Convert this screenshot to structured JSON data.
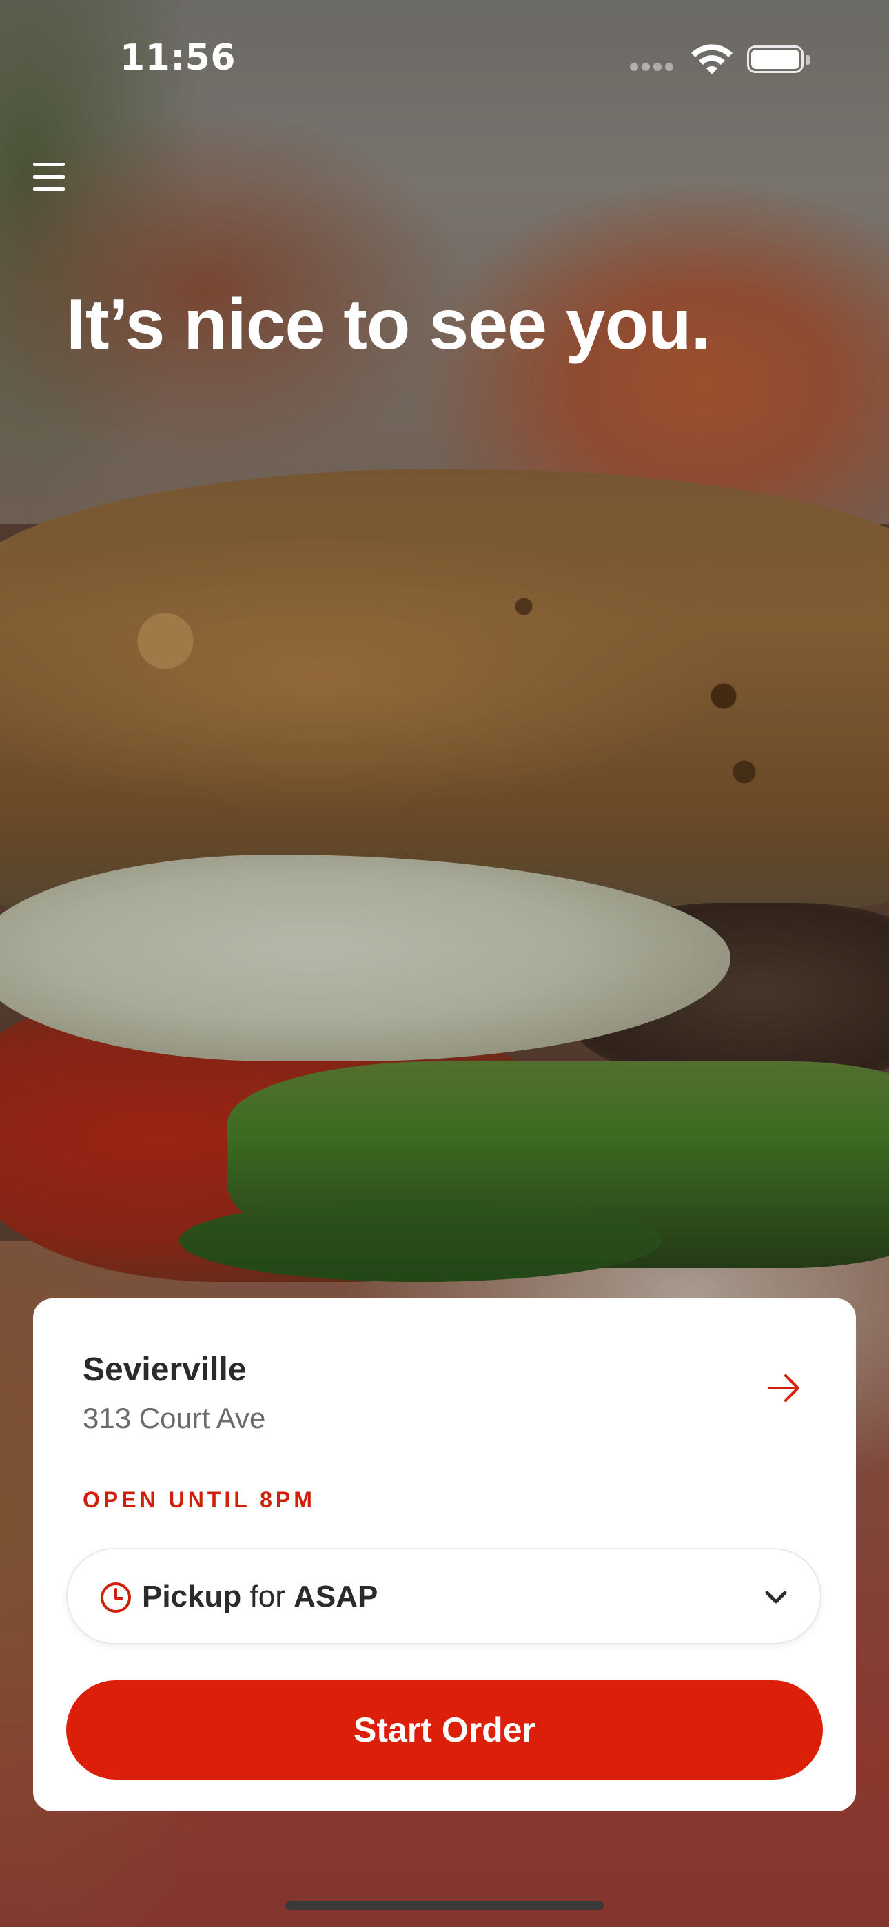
{
  "status_bar": {
    "time": "11:56"
  },
  "header": {
    "greeting": "It’s nice to see you."
  },
  "location": {
    "name": "Sevierville",
    "address": "313 Court Ave",
    "hours_status": "OPEN UNTIL 8PM"
  },
  "order_mode": {
    "method": "Pickup",
    "connector": "for",
    "timing": "ASAP"
  },
  "start_button": {
    "label": "Start Order"
  },
  "colors": {
    "accent": "#db1f08",
    "text_dark": "#2b2b2b",
    "text_muted": "#6b6b6b",
    "card_bg": "#ffffff"
  },
  "icons": [
    "menu-icon",
    "arrow-right-icon",
    "clock-icon",
    "chevron-down-icon",
    "wifi-icon",
    "battery-icon",
    "signal-icon"
  ]
}
